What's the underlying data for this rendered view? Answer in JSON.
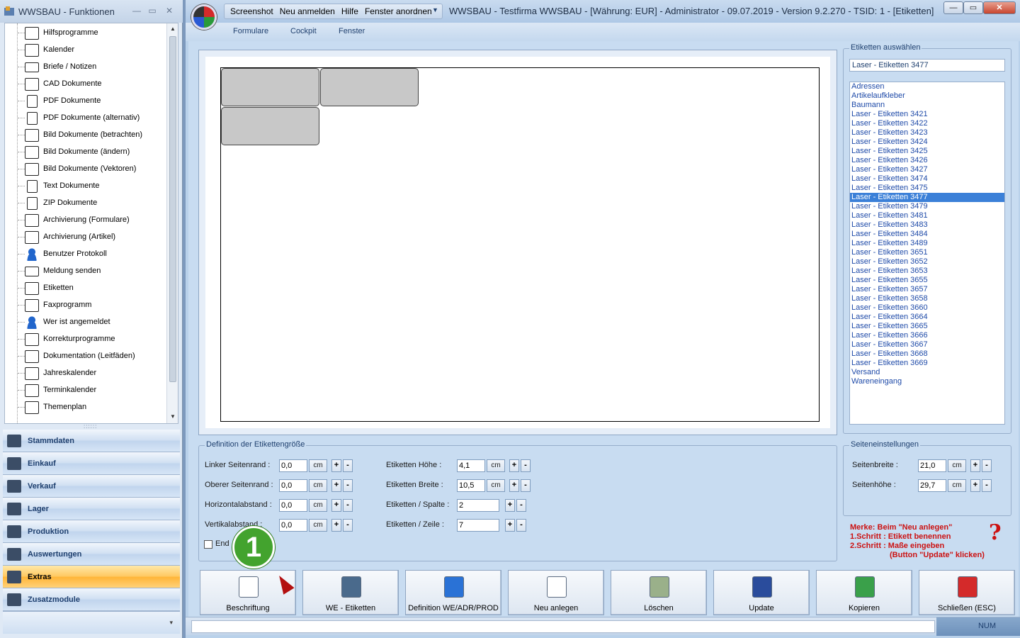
{
  "left_window": {
    "title": "WWSBAU - Funktionen",
    "tree_items": [
      "Hilfsprogramme",
      "Kalender",
      "Briefe / Notizen",
      "CAD Dokumente",
      "PDF Dokumente",
      "PDF Dokumente (alternativ)",
      "Bild Dokumente (betrachten)",
      "Bild Dokumente (ändern)",
      "Bild Dokumente (Vektoren)",
      "Text Dokumente",
      "ZIP Dokumente",
      "Archivierung (Formulare)",
      "Archivierung (Artikel)",
      "Benutzer Protokoll",
      "Meldung senden",
      "Etiketten",
      "Faxprogramm",
      "Wer ist angemeldet",
      "Korrekturprogramme",
      "Dokumentation (Leitfäden)",
      "Jahreskalender",
      "Terminkalender",
      "Themenplan"
    ],
    "nav_items": [
      "Stammdaten",
      "Einkauf",
      "Verkauf",
      "Lager",
      "Produktion",
      "Auswertungen",
      "Extras",
      "Zusatzmodule"
    ],
    "active_nav": "Extras"
  },
  "main_window": {
    "quick_access": [
      "Screenshot",
      "Neu anmelden",
      "Hilfe",
      "Fenster anordnen"
    ],
    "title": "WWSBAU - Testfirma WWSBAU - [Währung: EUR] - Administrator - 09.07.2019 - Version 9.2.270 - TSID: 1 - [Etiketten]",
    "menu": [
      "Formulare",
      "Cockpit",
      "Fenster"
    ]
  },
  "label_select": {
    "group_title": "Etiketten auswählen",
    "current": "Laser - Etiketten 3477",
    "items": [
      "Adressen",
      "Artikelaufkleber",
      "Baumann",
      "Laser - Etiketten 3421",
      "Laser - Etiketten 3422",
      "Laser - Etiketten 3423",
      "Laser - Etiketten 3424",
      "Laser - Etiketten 3425",
      "Laser - Etiketten 3426",
      "Laser - Etiketten 3427",
      "Laser - Etiketten 3474",
      "Laser - Etiketten 3475",
      "Laser - Etiketten 3477",
      "Laser - Etiketten 3479",
      "Laser - Etiketten 3481",
      "Laser - Etiketten 3483",
      "Laser - Etiketten 3484",
      "Laser - Etiketten 3489",
      "Laser - Etiketten 3651",
      "Laser - Etiketten 3652",
      "Laser - Etiketten 3653",
      "Laser - Etiketten 3655",
      "Laser - Etiketten 3657",
      "Laser - Etiketten 3658",
      "Laser - Etiketten 3660",
      "Laser - Etiketten 3664",
      "Laser - Etiketten 3665",
      "Laser - Etiketten 3666",
      "Laser - Etiketten 3667",
      "Laser - Etiketten 3668",
      "Laser - Etiketten 3669",
      "Versand",
      "Wareneingang"
    ],
    "selected": "Laser - Etiketten 3477"
  },
  "size_def": {
    "group_title": "Definition der Etikettengröße",
    "left": [
      {
        "label": "Linker Seitenrand :",
        "value": "0,0",
        "unit": "cm"
      },
      {
        "label": "Oberer Seitenrand :",
        "value": "0,0",
        "unit": "cm"
      },
      {
        "label": "Horizontalabstand :",
        "value": "0,0",
        "unit": "cm"
      },
      {
        "label": "Vertikalabstand :",
        "value": "0,0",
        "unit": "cm"
      }
    ],
    "right": [
      {
        "label": "Etiketten Höhe :",
        "value": "4,1",
        "unit": "cm"
      },
      {
        "label": "Etiketten Breite :",
        "value": "10,5",
        "unit": "cm"
      },
      {
        "label": "Etiketten / Spalte :",
        "value": "2",
        "unit": ""
      },
      {
        "label": "Etiketten / Zeile :",
        "value": "7",
        "unit": ""
      }
    ],
    "checkbox_label": "End"
  },
  "page_settings": {
    "group_title": "Seiteneinstellungen",
    "fields": [
      {
        "label": "Seitenbreite :",
        "value": "21,0",
        "unit": "cm"
      },
      {
        "label": "Seitenhöhe :",
        "value": "29,7",
        "unit": "cm"
      }
    ]
  },
  "plus": "+",
  "minus": "-",
  "note": {
    "line1": "Merke:  Beim \"Neu anlegen\"",
    "line2": "1.Schritt : Etikett benennen",
    "line3": "2.Schritt : Maße eingeben",
    "line4": "(Button \"Update\" klicken)",
    "mark": "?"
  },
  "buttons": [
    "Beschriftung",
    "WE - Etiketten",
    "Definition WE/ADR/PROD",
    "Neu anlegen",
    "Löschen",
    "Update",
    "Kopieren",
    "Schließen (ESC)"
  ],
  "badge": "1",
  "status": {
    "num": "NUM"
  },
  "colors": {
    "accent": "#3b80d8",
    "note": "#cc1111",
    "badge": "#43a32e",
    "active_nav": "#ffc860"
  }
}
